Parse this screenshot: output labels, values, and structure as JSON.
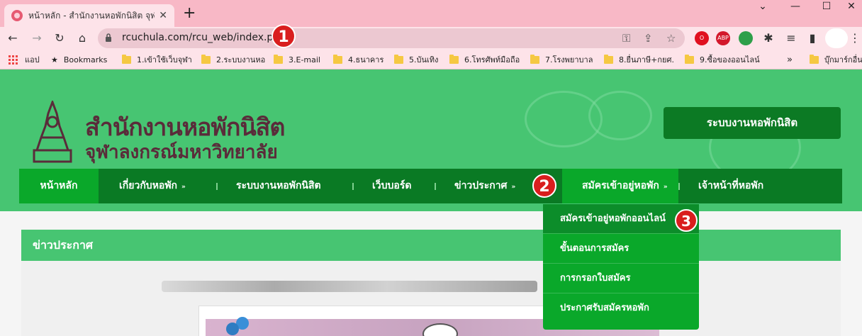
{
  "browser": {
    "tab_title": "หน้าหลัก - สำนักงานหอพักนิสิต จุฬาลงกรณ์",
    "tab_close": "✕",
    "new_tab": "+",
    "url": "rcuchula.com/rcu_web/index.php",
    "bookmarks": [
      {
        "label": "แอป",
        "type": "apps"
      },
      {
        "label": "Bookmarks",
        "type": "star"
      },
      {
        "label": "1.เข้าใช้เว็บจุฬา",
        "type": "folder"
      },
      {
        "label": "2.ระบบงานหอ",
        "type": "folder"
      },
      {
        "label": "3.E-mail",
        "type": "folder"
      },
      {
        "label": "4.ธนาคาร",
        "type": "folder"
      },
      {
        "label": "5.บันเทิง",
        "type": "folder"
      },
      {
        "label": "6.โทรศัพท์มือถือ",
        "type": "folder"
      },
      {
        "label": "7.โรงพยาบาล",
        "type": "folder"
      },
      {
        "label": "8.ยื่นภาษี+กยศ.",
        "type": "folder"
      },
      {
        "label": "9.ซื้อของออนไลน์",
        "type": "folder"
      },
      {
        "label": "»",
        "type": "more"
      },
      {
        "label": "บุ๊กมาร์กอื่น",
        "type": "folder"
      }
    ],
    "extensions": [
      "ABP"
    ]
  },
  "site": {
    "title_line1": "สำนักงานหอพักนิสิต",
    "title_line2": "จุฬาลงกรณ์มหาวิทยาลัย",
    "system_button": "ระบบงานหอพักนิสิต",
    "nav": [
      {
        "label": "หน้าหลัก",
        "caret": false
      },
      {
        "label": "เกี่ยวกับหอพัก",
        "caret": true
      },
      {
        "label": "ระบบงานหอพักนิสิต",
        "caret": false
      },
      {
        "label": "เว็บบอร์ด",
        "caret": false
      },
      {
        "label": "ข่าวประกาศ",
        "caret": true
      },
      {
        "label": "สมัครเข้าอยู่หอพัก",
        "caret": true
      },
      {
        "label": "เจ้าหน้าที่หอพัก",
        "caret": false
      }
    ],
    "dropdown": [
      "สมัครเข้าอยู่หอพักออนไลน์",
      "ขั้นตอนการสมัคร",
      "การกรอกใบสมัคร",
      "ประกาศรับสมัครหอพัก"
    ],
    "news_heading": "ข่าวประกาศ"
  },
  "markers": [
    "1",
    "2",
    "3"
  ],
  "colors": {
    "brand_green": "#47c572",
    "nav_green": "#0a7a24",
    "active_green": "#0aa82a",
    "marker_red": "#d91e1e",
    "title_maroon": "#5a2b3a"
  }
}
